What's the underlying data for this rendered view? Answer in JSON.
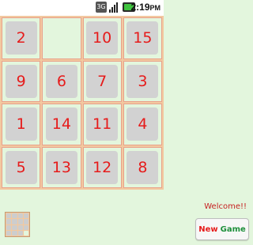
{
  "status_bar": {
    "network_label": "3G",
    "time": "2:19",
    "time_suffix": "PM",
    "icons": [
      "3g-icon",
      "signal-icon",
      "battery-icon"
    ]
  },
  "board": {
    "rows": [
      [
        "2",
        "",
        "10",
        "15"
      ],
      [
        "9",
        "6",
        "7",
        "3"
      ],
      [
        "1",
        "14",
        "11",
        "4"
      ],
      [
        "5",
        "13",
        "12",
        "8"
      ]
    ]
  },
  "welcome_text": "Welcome!!",
  "new_game": {
    "word1": "New",
    "word2": "Game"
  },
  "colors": {
    "background": "#e3f6dd",
    "grid_line": "#f2c9a0",
    "tile": "#d2d2d2",
    "number": "#e61b1b",
    "game_word": "#1e8f3b"
  }
}
